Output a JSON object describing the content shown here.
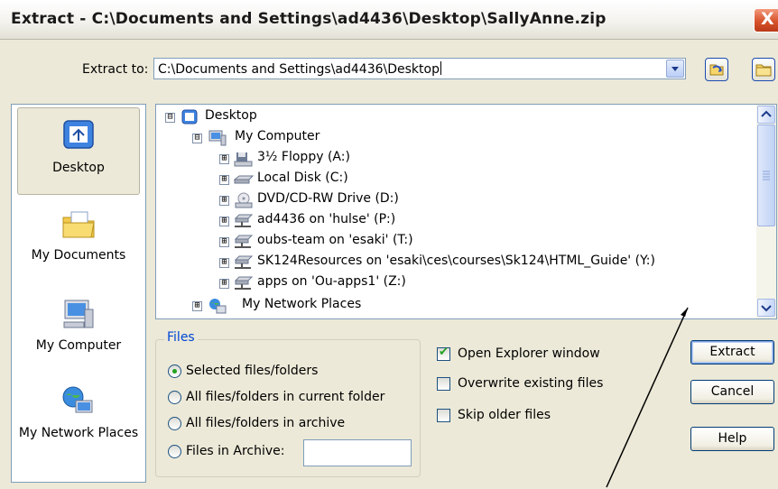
{
  "title": "Extract - C:\\Documents and Settings\\ad4436\\Desktop\\SallyAnne.zip",
  "close_label": "X",
  "extract_to": {
    "label": "Extract to:",
    "value": "C:\\Documents and Settings\\ad4436\\Desktop"
  },
  "places": [
    {
      "label": "Desktop",
      "icon": "desktop-icon"
    },
    {
      "label": "My Documents",
      "icon": "my-documents-icon"
    },
    {
      "label": "My Computer",
      "icon": "my-computer-icon"
    },
    {
      "label": "My Network Places",
      "icon": "network-places-icon"
    }
  ],
  "tree": [
    {
      "label": "Desktop",
      "expander": "⊟",
      "icon": "desktop-icon"
    },
    {
      "label": "My Computer",
      "expander": "⊟",
      "icon": "my-computer-icon"
    },
    {
      "label": "3½ Floppy (A:)",
      "expander": "⊞",
      "icon": "floppy-icon"
    },
    {
      "label": "Local Disk (C:)",
      "expander": "⊞",
      "icon": "hard-disk-icon"
    },
    {
      "label": "DVD/CD-RW Drive (D:)",
      "expander": "⊞",
      "icon": "cd-drive-icon"
    },
    {
      "label": "ad4436 on 'hulse' (P:)",
      "expander": "⊞",
      "icon": "network-drive-icon"
    },
    {
      "label": "oubs-team on 'esaki' (T:)",
      "expander": "⊞",
      "icon": "network-drive-icon"
    },
    {
      "label": "SK124Resources on 'esaki\\ces\\courses\\Sk124\\HTML_Guide' (Y:)",
      "expander": "⊞",
      "icon": "network-drive-icon"
    },
    {
      "label": "apps on 'Ou-apps1' (Z:)",
      "expander": "⊞",
      "icon": "network-drive-icon"
    },
    {
      "label": "My Network Places",
      "expander": "⊞",
      "icon": "network-places-icon"
    }
  ],
  "files": {
    "legend": "Files",
    "options": [
      {
        "label": "Selected files/folders",
        "selected": true
      },
      {
        "label": "All files/folders in current folder",
        "selected": false
      },
      {
        "label": "All files/folders in archive",
        "selected": false
      },
      {
        "label": "Files in Archive:",
        "selected": false
      }
    ],
    "archive_value": ""
  },
  "checks": [
    {
      "label": "Open Explorer window",
      "checked": true
    },
    {
      "label": "Overwrite existing files",
      "checked": false
    },
    {
      "label": "Skip older files",
      "checked": false
    }
  ],
  "buttons": {
    "extract": "Extract",
    "cancel": "Cancel",
    "help": "Help"
  },
  "colors": {
    "dialog_bg": "#ece9d8",
    "accent_blue": "#0046d5",
    "close_red": "#d8532b"
  }
}
